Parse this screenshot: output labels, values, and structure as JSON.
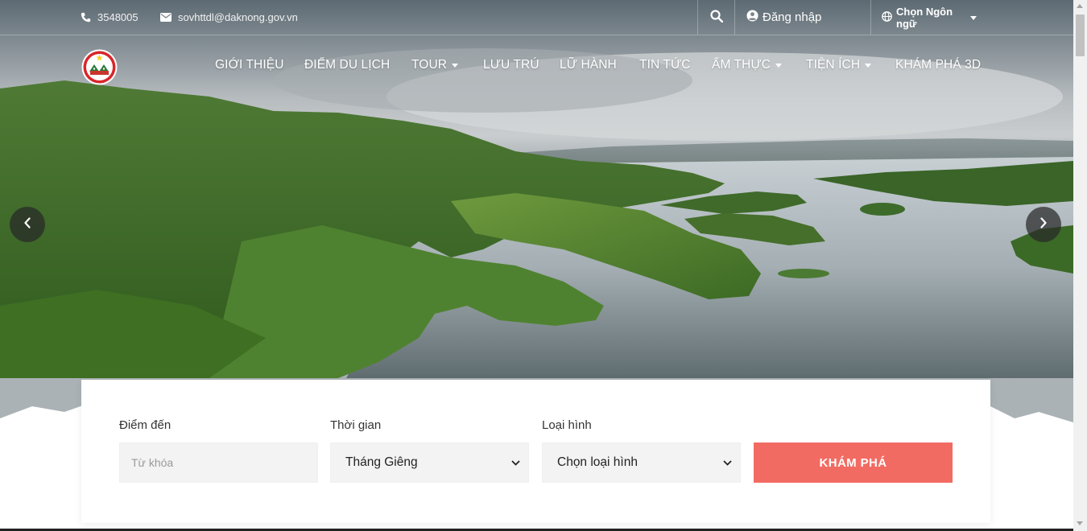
{
  "topbar": {
    "phone": "3548005",
    "email": "sovhttdl@daknong.gov.vn",
    "login_label": "Đăng nhập",
    "language_label": "Chọn Ngôn ngữ",
    "icons": {
      "phone": "phone-icon",
      "email": "envelope-icon",
      "search": "search-icon",
      "login": "user-circle-icon",
      "language": "globe-icon"
    }
  },
  "nav": {
    "items": [
      {
        "label": "GIỚI THIỆU",
        "has_dropdown": false
      },
      {
        "label": "ĐIỂM DU LỊCH",
        "has_dropdown": false
      },
      {
        "label": "TOUR",
        "has_dropdown": true
      },
      {
        "label": "LƯU TRÚ",
        "has_dropdown": false
      },
      {
        "label": "LỮ HÀNH",
        "has_dropdown": false
      },
      {
        "label": "TIN TỨC",
        "has_dropdown": false
      },
      {
        "label": "ẨM THỰC",
        "has_dropdown": true
      },
      {
        "label": "TIỆN ÍCH",
        "has_dropdown": true
      },
      {
        "label": "KHÁM PHÁ 3D",
        "has_dropdown": false
      }
    ]
  },
  "search": {
    "destination_label": "Điểm đến",
    "destination_placeholder": "Từ khóa",
    "time_label": "Thời gian",
    "time_value": "Tháng Giêng",
    "type_label": "Loại hình",
    "type_value": "Chọn loại hình",
    "submit_label": "KHÁM PHÁ"
  },
  "colors": {
    "accent": "#f26b62",
    "field_bg": "#f3f3f3"
  }
}
